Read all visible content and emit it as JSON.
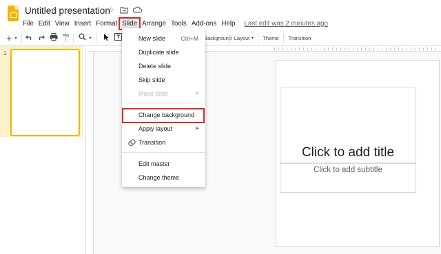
{
  "app": {
    "title": "Untitled presentation",
    "icons": [
      "star-icon",
      "folder-move-icon",
      "cloud-status-icon"
    ]
  },
  "menubar": {
    "items": [
      "File",
      "Edit",
      "View",
      "Insert",
      "Format",
      "Slide",
      "Arrange",
      "Tools",
      "Add-ons",
      "Help"
    ],
    "active": "Slide",
    "last_edit": "Last edit was 2 minutes ago"
  },
  "toolbar": {
    "icons": [
      "add-icon",
      "undo-icon",
      "redo-icon",
      "print-icon",
      "paint-format-icon",
      "zoom-icon",
      "select-icon",
      "text-box-icon"
    ],
    "background_label": "Background",
    "layout_label": "Layout",
    "theme_label": "Theme",
    "transition_label": "Transition"
  },
  "filmstrip": {
    "slides": [
      {
        "number": "1"
      }
    ]
  },
  "slide_menu": {
    "items": [
      {
        "label": "New slide",
        "shortcut": "Ctrl+M"
      },
      {
        "label": "Duplicate slide"
      },
      {
        "label": "Delete slide"
      },
      {
        "label": "Skip slide"
      },
      {
        "label": "Move slide",
        "disabled": true,
        "submenu": true
      },
      {
        "label": "Change background",
        "highlighted": true
      },
      {
        "label": "Apply layout",
        "submenu": true
      },
      {
        "label": "Transition",
        "icon": "transition-icon"
      },
      {
        "label": "Edit master"
      },
      {
        "label": "Change theme"
      }
    ],
    "highlight_color": "#d62b2b"
  },
  "slide": {
    "title_placeholder": "Click to add title",
    "subtitle_placeholder": "Click to add subtitle"
  },
  "colors": {
    "accent": "#f4b400",
    "highlight_red": "#d62b2b"
  }
}
